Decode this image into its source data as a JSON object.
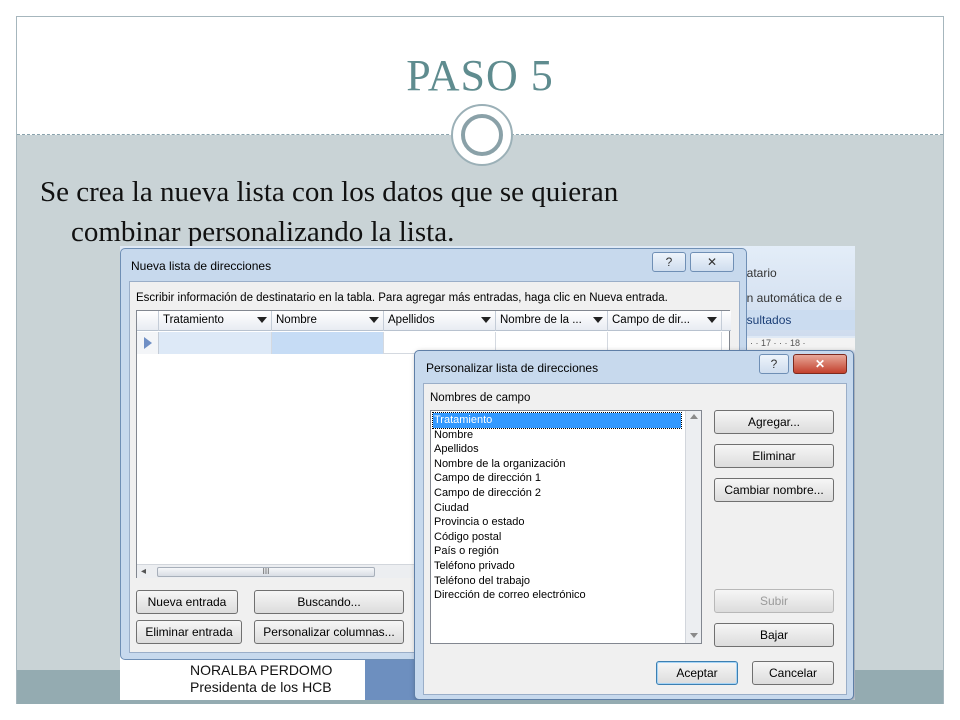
{
  "slide": {
    "title": "PASO 5",
    "body_line1": "Se crea la nueva lista con los datos que se quieran",
    "body_line2": "combinar personalizando la lista."
  },
  "background_window": {
    "ribbon_text_1": "natario",
    "ribbon_text_2": "ón automática de e",
    "ribbon_text_3": "esultados",
    "ruler_text": "· · 17 · · · 18 ·",
    "doc_line_1": "NORALBA PERDOMO",
    "doc_line_2": "Presidenta de los HCB"
  },
  "dialog_new_list": {
    "title": "Nueva lista de direcciones",
    "help_label": "?",
    "close_label": "✕",
    "instructions": "Escribir información de destinatario en la tabla. Para agregar más entradas, haga clic en Nueva entrada.",
    "columns": [
      "Tratamiento",
      "Nombre",
      "Apellidos",
      "Nombre de la ...",
      "Campo de dir..."
    ],
    "scroll_thumb_label": "III",
    "buttons": {
      "new_entry": "Nueva entrada",
      "search": "Buscando...",
      "delete_entry": "Eliminar entrada",
      "customize_columns": "Personalizar columnas..."
    }
  },
  "dialog_customize": {
    "title": "Personalizar lista de direcciones",
    "help_label": "?",
    "close_label": "✕",
    "field_names_label": "Nombres de campo",
    "fields": [
      "Tratamiento",
      "Nombre",
      "Apellidos",
      "Nombre de la organización",
      "Campo de dirección 1",
      "Campo de dirección 2",
      "Ciudad",
      "Provincia o estado",
      "Código postal",
      "País o región",
      "Teléfono privado",
      "Teléfono del trabajo",
      "Dirección de correo electrónico"
    ],
    "selected_field": "Tratamiento",
    "buttons": {
      "add": "Agregar...",
      "delete": "Eliminar",
      "rename": "Cambiar nombre...",
      "move_up": "Subir",
      "move_down": "Bajar",
      "ok": "Aceptar",
      "cancel": "Cancelar"
    }
  }
}
